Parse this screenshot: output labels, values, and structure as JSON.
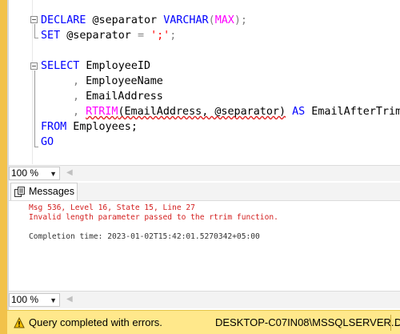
{
  "editor": {
    "lines": {
      "l1": {
        "kw1": "DECLARE",
        "var": " @separator ",
        "type": "VARCHAR",
        "p1": "(",
        "max": "MAX",
        "p2": ");"
      },
      "l2": {
        "kw": "SET",
        "rest": " @separator ",
        "eq": "=",
        "str": "';'",
        "semi": ";"
      },
      "l3": {
        "kw": "SELECT",
        "rest": " EmployeeID"
      },
      "l4": {
        "comma": ",",
        "rest": " EmployeeName"
      },
      "l5": {
        "comma": ",",
        "rest": " EmailAddress"
      },
      "l6": {
        "comma": ",",
        "fn": "RTRIM",
        "args": "(EmailAddress, @separator)",
        "as": "AS",
        "alias": " EmailAfterTrim"
      },
      "l7": {
        "kw": "FROM",
        "rest": " Employees;"
      },
      "l8": {
        "kw": "GO"
      }
    }
  },
  "zoom": {
    "editor_value": "100 %",
    "results_value": "100 %"
  },
  "messages": {
    "tab_label": "Messages",
    "error_line1": "Msg 536, Level 16, State 15, Line 27",
    "error_line2": "Invalid length parameter passed to the rtrim function.",
    "completion": "Completion time: 2023-01-02T15:42:01.5270342+05:00"
  },
  "status": {
    "text": "Query completed with errors.",
    "server": "DESKTOP-C07IN08\\MSSQLSERVER...",
    "more": "D"
  },
  "colors": {
    "keyword": "#0000ff",
    "function": "#ff00ff",
    "string": "#ff0000",
    "error": "#d32020",
    "status_bg": "#ffe88b",
    "accent_bar": "#f2c24b"
  }
}
